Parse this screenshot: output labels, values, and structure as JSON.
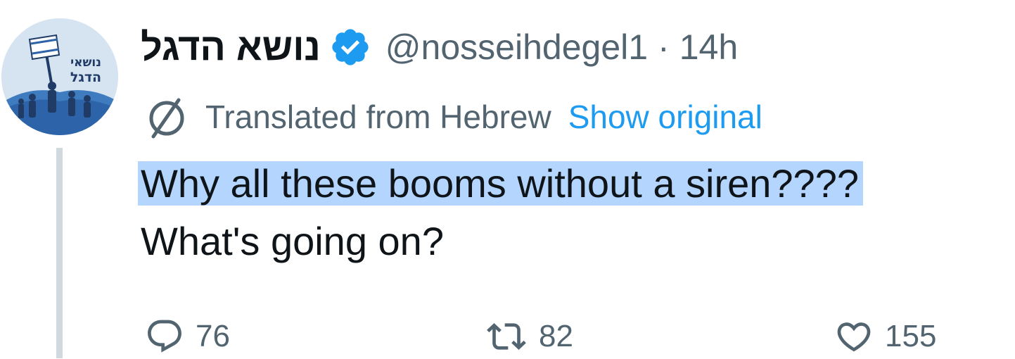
{
  "author": {
    "display_name": "נושא הדגל",
    "handle": "@nosseihdegel1",
    "separator": "·",
    "time": "14h",
    "avatar_logo_line1": "נושאי",
    "avatar_logo_line2": "הדגל",
    "verified_icon": "verified-badge-icon"
  },
  "translation": {
    "icon": "translate-globe-icon",
    "label": "Translated from Hebrew",
    "show_original": "Show original"
  },
  "tweet": {
    "line1": "Why all these booms without a siren????",
    "line2": "What's going on?"
  },
  "actions": {
    "reply_count": "76",
    "retweet_count": "82",
    "like_count": "155"
  },
  "colors": {
    "accent": "#1d9bf0",
    "secondary_text": "#536471",
    "highlight": "#b4d5fe",
    "thread_line": "#cfd9de"
  }
}
